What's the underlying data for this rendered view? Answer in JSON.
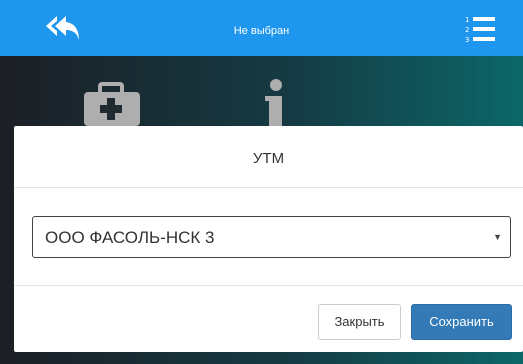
{
  "topbar": {
    "title": "Не выбран",
    "back_icon": "reply-all-icon",
    "menu_icon": "ordered-list-icon",
    "color": "#1f96ee"
  },
  "background_icons": [
    "first-aid-kit-icon",
    "info-icon"
  ],
  "modal": {
    "title": "УТМ",
    "select": {
      "value": "ООО ФАСОЛЬ-НСК 3"
    },
    "close_label": "Закрыть",
    "save_label": "Сохранить",
    "primary_color": "#337ab7"
  }
}
